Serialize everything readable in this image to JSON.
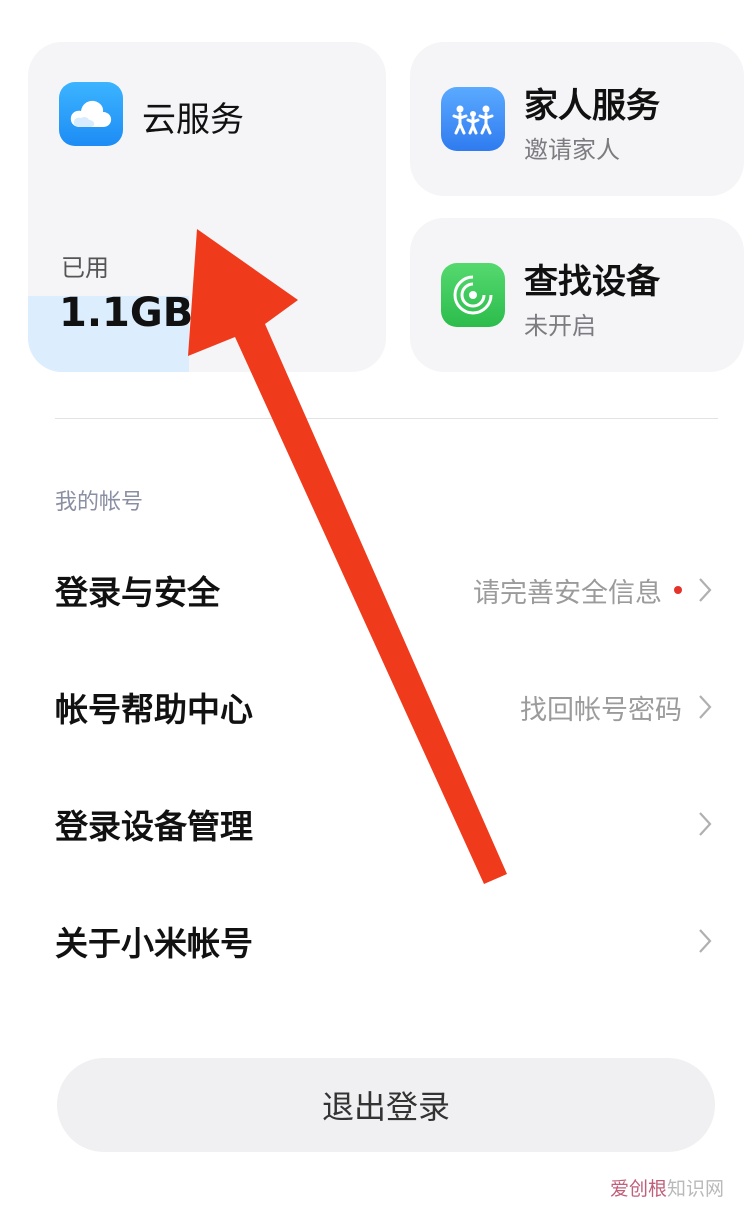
{
  "cards": {
    "cloud": {
      "title": "云服务",
      "used_label": "已用",
      "used_value": "1.1GB /",
      "icon": "cloud-icon",
      "storage_used_fraction": 0.45
    },
    "family": {
      "title": "家人服务",
      "subtitle": "邀请家人",
      "icon": "family-icon"
    },
    "find_device": {
      "title": "查找设备",
      "subtitle": "未开启",
      "icon": "radar-icon"
    }
  },
  "account": {
    "section_label": "我的帐号",
    "rows": [
      {
        "label": "登录与安全",
        "value": "请完善安全信息",
        "alert": true
      },
      {
        "label": "帐号帮助中心",
        "value": "找回帐号密码",
        "alert": false
      },
      {
        "label": "登录设备管理",
        "value": "",
        "alert": false
      },
      {
        "label": "关于小米帐号",
        "value": "",
        "alert": false
      }
    ]
  },
  "logout_label": "退出登录",
  "watermark": {
    "brand": "爱创根",
    "text": "知识网"
  },
  "colors": {
    "arrow": "#f03a1c",
    "alert_dot": "#e5322b",
    "storage_fill": "#dcedfd"
  }
}
